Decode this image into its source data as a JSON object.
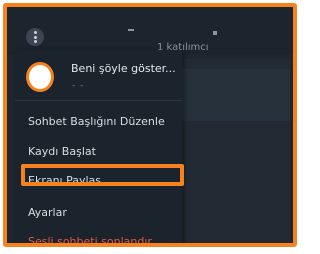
{
  "header": {
    "participants": "1 katılımcı"
  },
  "menu": {
    "profile": {
      "name": "Beni şöyle göster...",
      "subtitle": "- -"
    },
    "items": [
      {
        "label": "Sohbet Başlığını Düzenle"
      },
      {
        "label": "Kaydı Başlat"
      },
      {
        "label": "Ekranı Paylaş"
      },
      {
        "label": "Ayarlar"
      },
      {
        "label": "Sesli sohbeti sonlandır"
      }
    ]
  },
  "colors": {
    "accent": "#f5821f",
    "danger": "#e2574c",
    "background": "#1f2730"
  }
}
